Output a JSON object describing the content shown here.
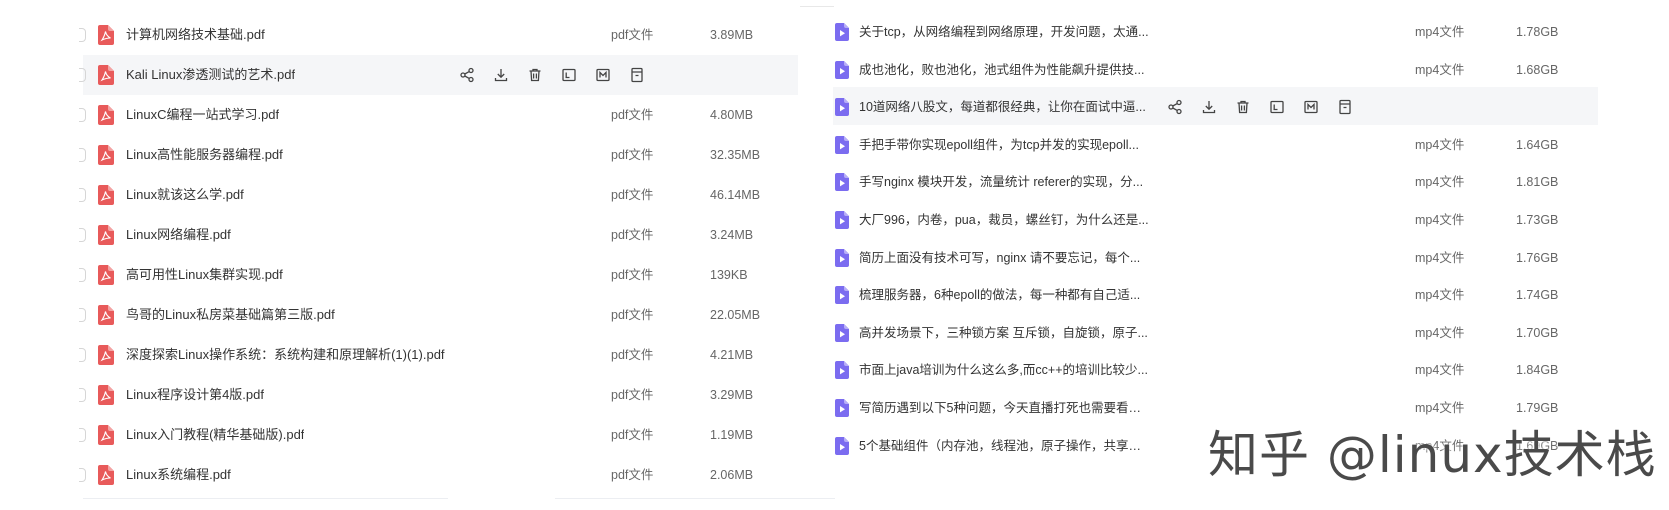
{
  "left_panel": {
    "files": [
      {
        "name": "计算机网络技术基础.pdf",
        "type": "pdf文件",
        "size": "3.89MB"
      },
      {
        "name": "Kali Linux渗透测试的艺术.pdf",
        "type": "",
        "size": ""
      },
      {
        "name": "LinuxC编程一站式学习.pdf",
        "type": "pdf文件",
        "size": "4.80MB"
      },
      {
        "name": "Linux高性能服务器编程.pdf",
        "type": "pdf文件",
        "size": "32.35MB"
      },
      {
        "name": "Linux就该这么学.pdf",
        "type": "pdf文件",
        "size": "46.14MB"
      },
      {
        "name": "Linux网络编程.pdf",
        "type": "pdf文件",
        "size": "3.24MB"
      },
      {
        "name": "高可用性Linux集群实现.pdf",
        "type": "pdf文件",
        "size": "139KB"
      },
      {
        "name": "鸟哥的Linux私房菜基础篇第三版.pdf",
        "type": "pdf文件",
        "size": "22.05MB"
      },
      {
        "name": "深度探索Linux操作系统：系统构建和原理解析(1)(1).pdf",
        "type": "pdf文件",
        "size": "4.21MB"
      },
      {
        "name": "Linux程序设计第4版.pdf",
        "type": "pdf文件",
        "size": "3.29MB"
      },
      {
        "name": "Linux入门教程(精华基础版).pdf",
        "type": "pdf文件",
        "size": "1.19MB"
      },
      {
        "name": "Linux系统编程.pdf",
        "type": "pdf文件",
        "size": "2.06MB"
      }
    ],
    "hover_index": 1
  },
  "right_panel": {
    "files": [
      {
        "name": "关于tcp，从网络编程到网络原理，开发问题，太通...",
        "type": "mp4文件",
        "size": "1.78GB"
      },
      {
        "name": "成也池化，败也池化，池式组件为性能飙升提供技...",
        "type": "mp4文件",
        "size": "1.68GB"
      },
      {
        "name": "10道网络八股文，每道都很经典，让你在面试中逼...",
        "type": "",
        "size": ""
      },
      {
        "name": "手把手带你实现epoll组件，为tcp并发的实现epoll...",
        "type": "mp4文件",
        "size": "1.64GB"
      },
      {
        "name": "手写nginx 模块开发，流量统计 referer的实现，分...",
        "type": "mp4文件",
        "size": "1.81GB"
      },
      {
        "name": "大厂996，内卷，pua，裁员，螺丝钉，为什么还是...",
        "type": "mp4文件",
        "size": "1.73GB"
      },
      {
        "name": "简历上面没有技术可写，nginx 请不要忘记，每个...",
        "type": "mp4文件",
        "size": "1.76GB"
      },
      {
        "name": "梳理服务器，6种epoll的做法，每一种都有自己适...",
        "type": "mp4文件",
        "size": "1.74GB"
      },
      {
        "name": "高并发场景下，三种锁方案 互斥锁，自旋锁，原子...",
        "type": "mp4文件",
        "size": "1.70GB"
      },
      {
        "name": "市面上java培训为什么这么多,而cc++的培训比较少...",
        "type": "mp4文件",
        "size": "1.84GB"
      },
      {
        "name": "写简历遇到以下5种问题，今天直播打死也需要看完...",
        "type": "mp4文件",
        "size": "1.79GB"
      },
      {
        "name": "5个基础组件（内存池，线程池，原子操作，共享内...",
        "type": "mp4文件",
        "size": "1.69GB"
      }
    ],
    "hover_index": 2
  },
  "actions": [
    {
      "name": "share",
      "icon": "share-icon"
    },
    {
      "name": "download",
      "icon": "download-icon"
    },
    {
      "name": "delete",
      "icon": "trash-icon"
    },
    {
      "name": "rename",
      "icon": "rename-icon"
    },
    {
      "name": "move",
      "icon": "move-icon"
    },
    {
      "name": "more",
      "icon": "more-icon"
    }
  ],
  "colors": {
    "pdf": "#e85a5a",
    "video": "#7b6cf0",
    "text": "#333333",
    "muted": "#666666",
    "hover_bg": "#f5f6f8",
    "icon": "#444444"
  },
  "watermark": "知乎 @linux技术栈"
}
